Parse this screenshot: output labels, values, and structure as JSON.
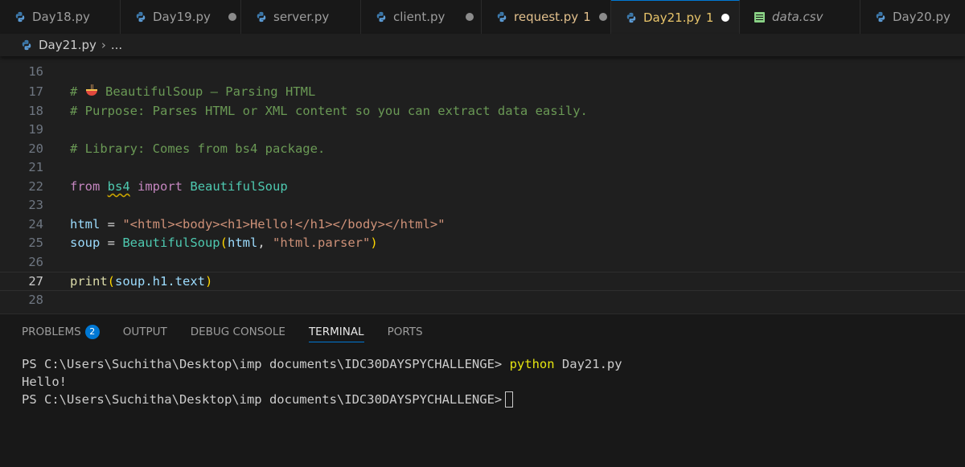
{
  "tabs": [
    {
      "label": "Day18.py",
      "icon": "python-icon",
      "width": 150
    },
    {
      "label": "Day19.py",
      "icon": "python-icon",
      "width": 150,
      "dot": true
    },
    {
      "label": "server.py",
      "icon": "python-icon",
      "width": 149
    },
    {
      "label": "client.py",
      "icon": "python-icon",
      "width": 150,
      "dot": true
    },
    {
      "label": "request.py",
      "icon": "python-icon",
      "width": 161,
      "count": "1",
      "dot": true
    },
    {
      "label": "Day21.py",
      "icon": "python-icon",
      "width": 160,
      "count": "1",
      "dot": true,
      "active": true
    },
    {
      "label": "data.csv",
      "icon": "csv-icon",
      "width": 150,
      "italic": true
    },
    {
      "label": "Day20.py",
      "icon": "python-icon",
      "width": 130
    }
  ],
  "breadcrumb": {
    "file": "Day21.py",
    "rest": "..."
  },
  "editor": {
    "line_numbers": [
      "16",
      "17",
      "18",
      "19",
      "20",
      "21",
      "22",
      "23",
      "24",
      "25",
      "26",
      "27",
      "28"
    ],
    "current_line": "27",
    "l17_hash": "# ",
    "l17_text": " BeautifulSoup – Parsing HTML",
    "l18": "# Purpose: Parses HTML or XML content so you can extract data easily.",
    "l20": "# Library: Comes from bs4 package.",
    "l22_from": "from",
    "l22_module": "bs4",
    "l22_import": "import",
    "l22_class": "BeautifulSoup",
    "l24_var": "html",
    "l24_eq": " = ",
    "l24_str": "\"<html><body><h1>Hello!</h1></body></html>\"",
    "l25_var": "soup",
    "l25_eq": " = ",
    "l25_class": "BeautifulSoup",
    "l25_arg": "html",
    "l25_comma": ", ",
    "l25_str": "\"html.parser\"",
    "l27_fn": "print",
    "l27_arg": "soup.h1.text"
  },
  "panel": {
    "tabs": [
      "PROBLEMS",
      "OUTPUT",
      "DEBUG CONSOLE",
      "TERMINAL",
      "PORTS"
    ],
    "problems_count": "2",
    "active_tab": "TERMINAL",
    "terminal": {
      "prompt1": "PS C:\\Users\\Suchitha\\Desktop\\imp documents\\IDC30DAYSPYCHALLENGE> ",
      "command": "python",
      "command_arg": " Day21.py",
      "output": "Hello!",
      "prompt2": "PS C:\\Users\\Suchitha\\Desktop\\imp documents\\IDC30DAYSPYCHALLENGE>"
    }
  },
  "colors": {
    "accent": "#0078d4",
    "modified": "#e2c08d",
    "comment": "#6a9955"
  }
}
